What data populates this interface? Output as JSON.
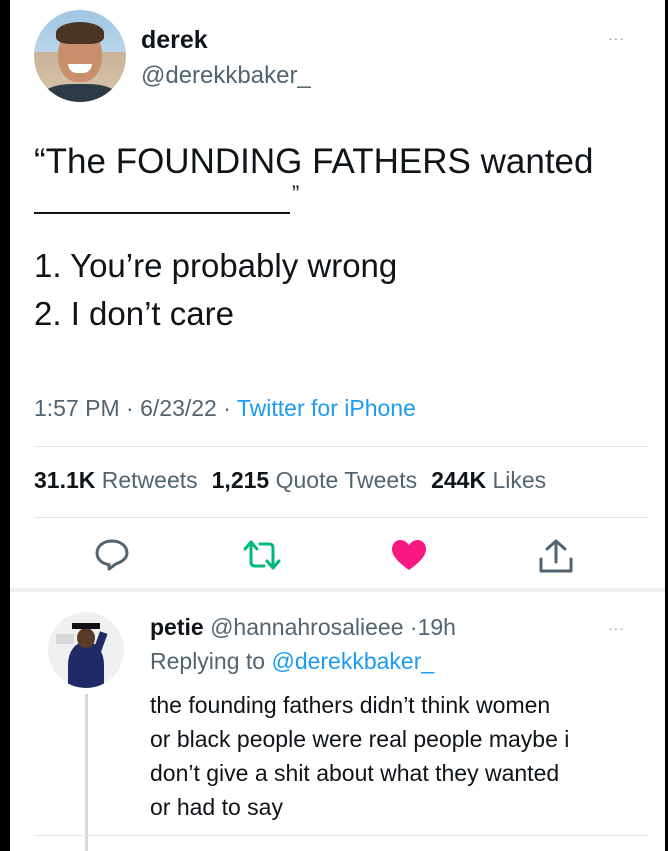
{
  "tweet": {
    "display_name": "derek",
    "handle": "@derekkbaker_",
    "more_label": "···",
    "text_line1": "“The FOUNDING FATHERS wanted",
    "close_quote": "”",
    "list": [
      "1. You’re probably wrong",
      "2. I don’t care"
    ],
    "time": "1:57 PM",
    "date": "6/23/22",
    "separator": "·",
    "source": "Twitter for iPhone"
  },
  "stats": {
    "retweets_count": "31.1K",
    "retweets_label": "Retweets",
    "quotes_count": "1,215",
    "quotes_label": "Quote Tweets",
    "likes_count": "244K",
    "likes_label": "Likes"
  },
  "actions": [
    {
      "name": "reply-icon",
      "color": "#536471"
    },
    {
      "name": "retweet-icon",
      "color": "#00ba7c"
    },
    {
      "name": "like-icon",
      "color": "#f91880",
      "liked": true
    },
    {
      "name": "share-icon",
      "color": "#536471"
    }
  ],
  "reply": {
    "display_name": "petie",
    "handle": "@hannahrosalieee",
    "separator": "·",
    "time": "19h",
    "more_label": "···",
    "replying_to_label": "Replying to",
    "replying_to_handle": "@derekkbaker_",
    "text_lines": [
      "the founding fathers didn’t think women",
      "or black people were real people maybe i",
      "don’t give a shit about what they wanted",
      "or had to say"
    ]
  },
  "colors": {
    "text": "#0f1419",
    "secondary": "#536471",
    "link": "#1d9bf0",
    "like": "#f91880",
    "retweet": "#00ba7c"
  }
}
